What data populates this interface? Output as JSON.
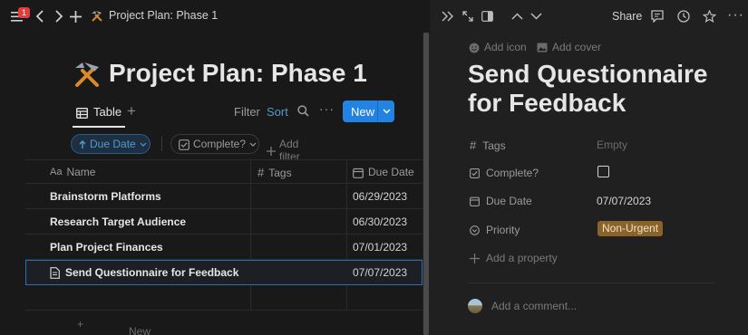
{
  "topbar": {
    "notification_count": "1",
    "breadcrumb": "Project Plan: Phase 1"
  },
  "page": {
    "title": "Project Plan: Phase 1"
  },
  "view": {
    "tab_label": "Table",
    "filter_label": "Filter",
    "sort_label": "Sort",
    "more_label": "···",
    "new_label": "New"
  },
  "filters": {
    "sort_pill": "Due Date",
    "complete_pill": "Complete?",
    "add_filter": "Add filter"
  },
  "table": {
    "columns": [
      "Name",
      "Tags",
      "Due Date"
    ],
    "rows": [
      {
        "name": "Brainstorm Platforms",
        "tags": "",
        "due": "06/29/2023"
      },
      {
        "name": "Research Target Audience",
        "tags": "",
        "due": "06/30/2023"
      },
      {
        "name": "Plan Project Finances",
        "tags": "",
        "due": "07/01/2023"
      },
      {
        "name": "Send Questionnaire for Feedback",
        "tags": "",
        "due": "07/07/2023"
      }
    ],
    "add_row_label": "New"
  },
  "side_peek": {
    "share_label": "Share",
    "add_icon": "Add icon",
    "add_cover": "Add cover",
    "title": "Send Questionnaire for Feedback",
    "properties": {
      "tags_label": "Tags",
      "tags_value": "Empty",
      "complete_label": "Complete?",
      "complete_checked": false,
      "due_label": "Due Date",
      "due_value": "07/07/2023",
      "priority_label": "Priority",
      "priority_value": "Non-Urgent"
    },
    "add_property": "Add a property",
    "comment_placeholder": "Add a comment..."
  },
  "colors": {
    "accent": "#2383e2",
    "link": "#529cca",
    "priority_tag_bg": "#89632a",
    "badge": "#e03e3e"
  }
}
